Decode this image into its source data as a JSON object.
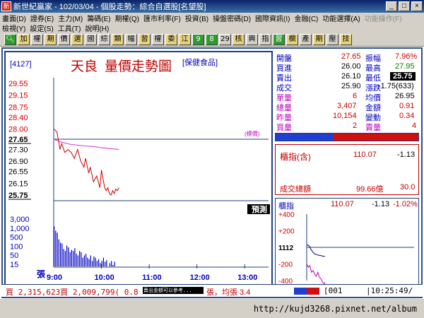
{
  "window": {
    "title": "新世紀贏家 - 102/03/04 - 個股走勢：綜合自選股[名望股]",
    "app_icon": "新"
  },
  "menu": {
    "row1": [
      "畫面(D)",
      "證券(E)",
      "主力(M)",
      "籌碼(E)",
      "期權(Q)",
      "匯市利率(F)",
      "投資(B)",
      "操盤密碼(D)",
      "國際資訊(I)",
      "金融(C)",
      "功能選擇(A)",
      "功能操作(F)"
    ],
    "row2": [
      "檢視(Y)",
      "設定(S)",
      "工具(T)",
      "說明(H)"
    ]
  },
  "toolbar": {
    "buttons": [
      "加",
      "權",
      "期",
      "價",
      "選",
      "國",
      "綜",
      "類",
      "幅",
      "習",
      "權",
      "委",
      "江",
      "9",
      "8",
      "29",
      "核",
      "興",
      "指",
      "習",
      "欄",
      "產",
      "期",
      "壓",
      "技"
    ],
    "search_icon": "magnifier-icon"
  },
  "stock": {
    "code": "[4127]",
    "name": "天良",
    "chart_title": "量價走勢圖",
    "category": "[保健食品]"
  },
  "quote": {
    "open_label": "開盤",
    "open": "27.65",
    "amplitude_label": "振幅",
    "amplitude": "7.96%",
    "bid_label": "買進",
    "bid": "26.00",
    "high_label": "最高",
    "high": "27.95",
    "ask_label": "賣出",
    "ask": "26.10",
    "low_label": "最低",
    "low": "25.75",
    "deal_label": "成交",
    "deal": "25.90",
    "change_label": "漲跌",
    "change": "-1.75(633)",
    "single_label": "單量",
    "single": "6",
    "avg_label": "均價",
    "avg": "26.95",
    "total_label": "總量",
    "total": "3,407",
    "amount_label": "金額",
    "amount": "0.91",
    "yesterday_label": "昨量",
    "yesterday": "10,154",
    "variation_label": "變動",
    "variation": "0.34",
    "buy_vol_label": "買量",
    "buy_vol": "2",
    "sell_vol_label": "賣量",
    "sell_vol": "4"
  },
  "index_box": {
    "label": "櫃指(含)",
    "value": "110.07",
    "change": "-1.13",
    "turnover_label": "成交總額",
    "turnover": "99.66億",
    "turnover_ratio": "30.0"
  },
  "mini_index": {
    "label": "櫃指",
    "value": "110.07",
    "change": "-1.13",
    "pct": "-1.02%",
    "ticks": [
      "+400",
      "+200",
      "1112",
      "-200",
      "-400"
    ]
  },
  "chart_labels": {
    "prev_close_tag": "(標價)",
    "forecast_btn": "預測",
    "volume_unit": "張"
  },
  "status": {
    "left": "買 2,315,623買 2,009,799( 0.8",
    "overlay": "賣出金額可以參考...",
    "mid": "張，均張 3.4",
    "code": "001",
    "time": "10:25:49"
  },
  "url": "http://kujd3268.pixnet.net/album",
  "chart_data": {
    "type": "line",
    "price_axis": [
      29.55,
      29.15,
      28.75,
      28.4,
      28.0,
      27.65,
      27.3,
      26.9,
      26.55,
      26.15,
      25.75
    ],
    "volume_axis": [
      3000,
      1000,
      500,
      100,
      50,
      15
    ],
    "x_ticks": [
      "9:00",
      "10:00",
      "11:00",
      "12:00",
      "13:00"
    ],
    "prev_close": 27.65,
    "price_series": {
      "name": "price",
      "x": [
        0,
        4,
        8,
        10,
        14,
        18,
        22,
        26,
        30,
        34,
        38,
        40,
        44,
        46,
        50,
        54,
        58,
        60,
        62,
        64,
        66,
        68,
        70,
        72,
        74,
        76,
        78,
        80,
        82
      ],
      "y": [
        28.0,
        27.9,
        27.3,
        27.5,
        27.2,
        27.3,
        27.2,
        27.0,
        27.3,
        26.9,
        26.7,
        27.0,
        26.5,
        26.7,
        26.2,
        26.4,
        26.0,
        26.6,
        26.3,
        26.0,
        25.9,
        26.0,
        25.8,
        25.75,
        25.9,
        25.8,
        25.95,
        25.9,
        26.0
      ]
    },
    "avg_series": {
      "name": "avg",
      "x": [
        0,
        10,
        20,
        30,
        40,
        50,
        60,
        70,
        82
      ],
      "y": [
        27.65,
        27.55,
        27.48,
        27.45,
        27.42,
        27.4,
        27.36,
        27.33,
        27.3
      ]
    },
    "volume_series": {
      "name": "volume",
      "values": [
        1600,
        900,
        700,
        300,
        200,
        180,
        90,
        70,
        140,
        110,
        60,
        80,
        70,
        100,
        50,
        40,
        70,
        60,
        30,
        40,
        50,
        30,
        25,
        40,
        20,
        35,
        30,
        20,
        25,
        15,
        20,
        30,
        18,
        22,
        10,
        15,
        20,
        12,
        18,
        10,
        8
      ]
    },
    "mini_series": {
      "name": "index",
      "x": [
        0,
        6,
        10,
        16,
        20,
        26,
        30,
        36,
        40,
        46
      ],
      "y": [
        30,
        20,
        -20,
        -60,
        -80,
        -90,
        -95,
        -100,
        -105,
        -110
      ]
    },
    "mini_price": {
      "x": [
        0,
        4,
        8,
        12,
        16,
        20,
        24,
        28,
        32,
        36,
        38,
        40,
        44,
        46
      ],
      "y": [
        -200,
        -240,
        -220,
        -300,
        -280,
        -320,
        -350,
        -300,
        -360,
        -380,
        -400,
        -420,
        -440,
        -420
      ]
    }
  }
}
